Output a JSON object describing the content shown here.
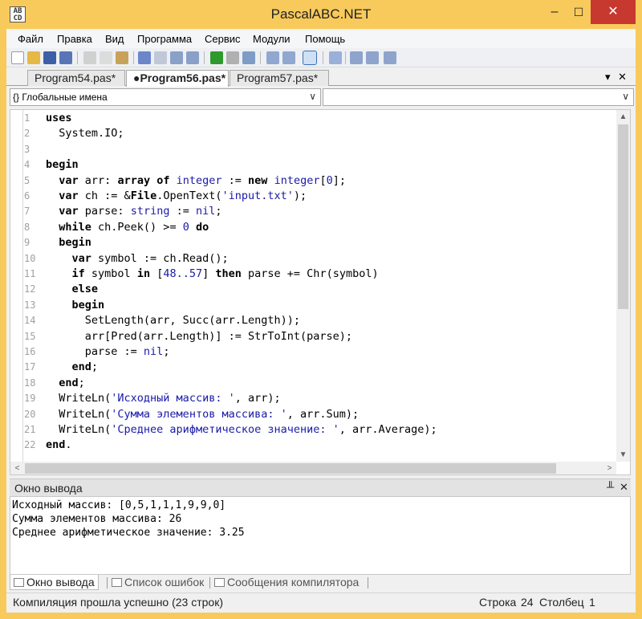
{
  "window": {
    "title": "PascalABC.NET",
    "app_icon_text": "AB\nCD",
    "min_label": "–",
    "max_label": "☐",
    "close_label": "✕"
  },
  "menu": {
    "items": [
      "Файл",
      "Правка",
      "Вид",
      "Программа",
      "Сервис",
      "Модули",
      "Помощь"
    ]
  },
  "tabs": {
    "items": [
      {
        "label": "Program54.pas*",
        "active": false
      },
      {
        "label": "●Program56.pas*",
        "active": true
      },
      {
        "label": "Program57.pas*",
        "active": false
      }
    ],
    "dropdown_label": "▾",
    "close_label": "✕"
  },
  "combos": {
    "scope": "{} Глобальные имена",
    "member": "",
    "arrow": "∨"
  },
  "editor": {
    "lines": [
      {
        "n": "1",
        "tokens": [
          [
            "kw",
            "uses"
          ]
        ]
      },
      {
        "n": "2",
        "tokens": [
          [
            "pl",
            "  System.IO;"
          ]
        ]
      },
      {
        "n": "3",
        "tokens": []
      },
      {
        "n": "4",
        "tokens": [
          [
            "kw",
            "begin"
          ]
        ]
      },
      {
        "n": "5",
        "tokens": [
          [
            "pl",
            "  "
          ],
          [
            "kw",
            "var"
          ],
          [
            "pl",
            " arr: "
          ],
          [
            "kw",
            "array of"
          ],
          [
            "pl",
            " "
          ],
          [
            "ty",
            "integer"
          ],
          [
            "pl",
            " := "
          ],
          [
            "kw",
            "new"
          ],
          [
            "pl",
            " "
          ],
          [
            "ty",
            "integer"
          ],
          [
            "pl",
            "["
          ],
          [
            "nm",
            "0"
          ],
          [
            "pl",
            "];"
          ]
        ]
      },
      {
        "n": "6",
        "tokens": [
          [
            "pl",
            "  "
          ],
          [
            "kw",
            "var"
          ],
          [
            "pl",
            " ch := &"
          ],
          [
            "kw",
            "File"
          ],
          [
            "pl",
            ".OpenText("
          ],
          [
            "st",
            "'input.txt'"
          ],
          [
            "pl",
            ");"
          ]
        ]
      },
      {
        "n": "7",
        "tokens": [
          [
            "pl",
            "  "
          ],
          [
            "kw",
            "var"
          ],
          [
            "pl",
            " parse: "
          ],
          [
            "ty",
            "string"
          ],
          [
            "pl",
            " := "
          ],
          [
            "ty",
            "nil"
          ],
          [
            "pl",
            ";"
          ]
        ]
      },
      {
        "n": "8",
        "tokens": [
          [
            "pl",
            "  "
          ],
          [
            "kw",
            "while"
          ],
          [
            "pl",
            " ch.Peek() >= "
          ],
          [
            "nm",
            "0"
          ],
          [
            "pl",
            " "
          ],
          [
            "kw",
            "do"
          ]
        ]
      },
      {
        "n": "9",
        "tokens": [
          [
            "pl",
            "  "
          ],
          [
            "kw",
            "begin"
          ]
        ]
      },
      {
        "n": "10",
        "tokens": [
          [
            "pl",
            "    "
          ],
          [
            "kw",
            "var"
          ],
          [
            "pl",
            " symbol := ch.Read();"
          ]
        ]
      },
      {
        "n": "11",
        "tokens": [
          [
            "pl",
            "    "
          ],
          [
            "kw",
            "if"
          ],
          [
            "pl",
            " symbol "
          ],
          [
            "kw",
            "in"
          ],
          [
            "pl",
            " ["
          ],
          [
            "nm",
            "48..57"
          ],
          [
            "pl",
            "] "
          ],
          [
            "kw",
            "then"
          ],
          [
            "pl",
            " parse += Chr(symbol)"
          ]
        ]
      },
      {
        "n": "12",
        "tokens": [
          [
            "pl",
            "    "
          ],
          [
            "kw",
            "else"
          ]
        ]
      },
      {
        "n": "13",
        "tokens": [
          [
            "pl",
            "    "
          ],
          [
            "kw",
            "begin"
          ]
        ]
      },
      {
        "n": "14",
        "tokens": [
          [
            "pl",
            "      SetLength(arr, Succ(arr.Length));"
          ]
        ]
      },
      {
        "n": "15",
        "tokens": [
          [
            "pl",
            "      arr[Pred(arr.Length)] := StrToInt(parse);"
          ]
        ]
      },
      {
        "n": "16",
        "tokens": [
          [
            "pl",
            "      parse := "
          ],
          [
            "ty",
            "nil"
          ],
          [
            "pl",
            ";"
          ]
        ]
      },
      {
        "n": "17",
        "tokens": [
          [
            "pl",
            "    "
          ],
          [
            "kw",
            "end"
          ],
          [
            "pl",
            ";"
          ]
        ]
      },
      {
        "n": "18",
        "tokens": [
          [
            "pl",
            "  "
          ],
          [
            "kw",
            "end"
          ],
          [
            "pl",
            ";"
          ]
        ]
      },
      {
        "n": "19",
        "tokens": [
          [
            "pl",
            "  WriteLn("
          ],
          [
            "st",
            "'Исходный массив: '"
          ],
          [
            "pl",
            ", arr);"
          ]
        ]
      },
      {
        "n": "20",
        "tokens": [
          [
            "pl",
            "  WriteLn("
          ],
          [
            "st",
            "'Сумма элементов массива: '"
          ],
          [
            "pl",
            ", arr.Sum);"
          ]
        ]
      },
      {
        "n": "21",
        "tokens": [
          [
            "pl",
            "  WriteLn("
          ],
          [
            "st",
            "'Среднее арифметическое значение: '"
          ],
          [
            "pl",
            ", arr.Average);"
          ]
        ]
      },
      {
        "n": "22",
        "tokens": [
          [
            "kw",
            "end"
          ],
          [
            "pl",
            "."
          ]
        ]
      }
    ],
    "scroll_up": "▲",
    "scroll_down": "▼",
    "scroll_left": "<",
    "scroll_right": ">"
  },
  "output": {
    "title": "Окно вывода",
    "pin_label": "╨",
    "close_label": "✕",
    "lines": [
      "Исходный массив: [0,5,1,1,1,9,9,0]",
      "Сумма элементов массива: 26",
      "Среднее арифметическое значение: 3.25"
    ]
  },
  "bottom_tabs": [
    "Окно вывода",
    "Список ошибок",
    "Сообщения компилятора"
  ],
  "status": {
    "message": "Компиляция прошла успешно (23 строк)",
    "line_label": "Строка",
    "line_value": "24",
    "col_label": "Столбец",
    "col_value": "1"
  },
  "colors": {
    "frame": "#f8ca5c",
    "close": "#c7382f",
    "keyword": "#000000",
    "type_string": "#1a1aa8"
  }
}
